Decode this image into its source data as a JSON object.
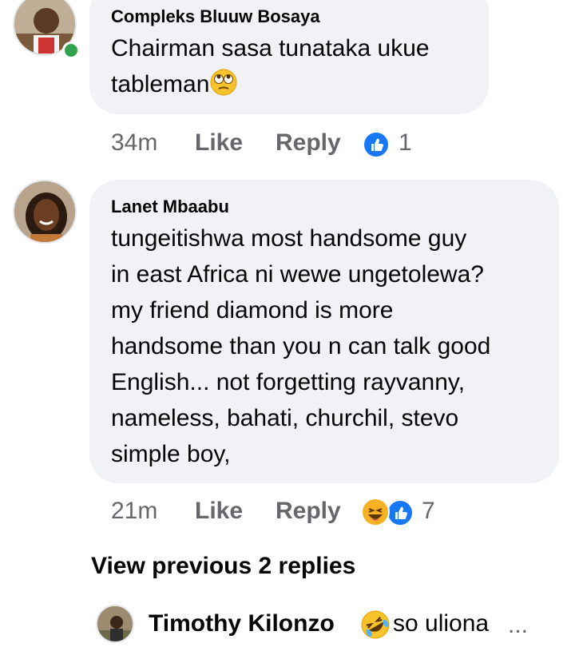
{
  "comments": [
    {
      "author": "Compleks Bluuw Bosaya",
      "text_lines": [
        "Chairman sasa tunataka ukue",
        "tableman"
      ],
      "emoji": "face-with-rolling-eyes",
      "time": "34m",
      "like_label": "Like",
      "reply_label": "Reply",
      "reactions": [
        "like"
      ],
      "reaction_count": "1",
      "online": true
    },
    {
      "author": "Lanet Mbaabu",
      "text_lines": [
        "tungeitishwa most handsome guy",
        "in east Africa ni wewe ungetolewa?",
        "my friend diamond is more",
        "handsome than you n can talk good",
        "English... not forgetting rayvanny,",
        "nameless, bahati, churchil, stevo",
        "simple boy,"
      ],
      "time": "21m",
      "like_label": "Like",
      "reply_label": "Reply",
      "reactions": [
        "haha",
        "like"
      ],
      "reaction_count": "7"
    }
  ],
  "view_previous": "View previous 2 replies",
  "reply_preview": {
    "author": "Timothy Kilonzo",
    "emoji": "rolling-on-floor-laughing",
    "text": "so uliona",
    "ellipsis": "..."
  },
  "colors": {
    "bubble": "#f0f2f5",
    "meta": "#65676b",
    "like_blue": "#1877f2",
    "online_green": "#31a24c",
    "emoji_yellow": "#f7b125"
  }
}
